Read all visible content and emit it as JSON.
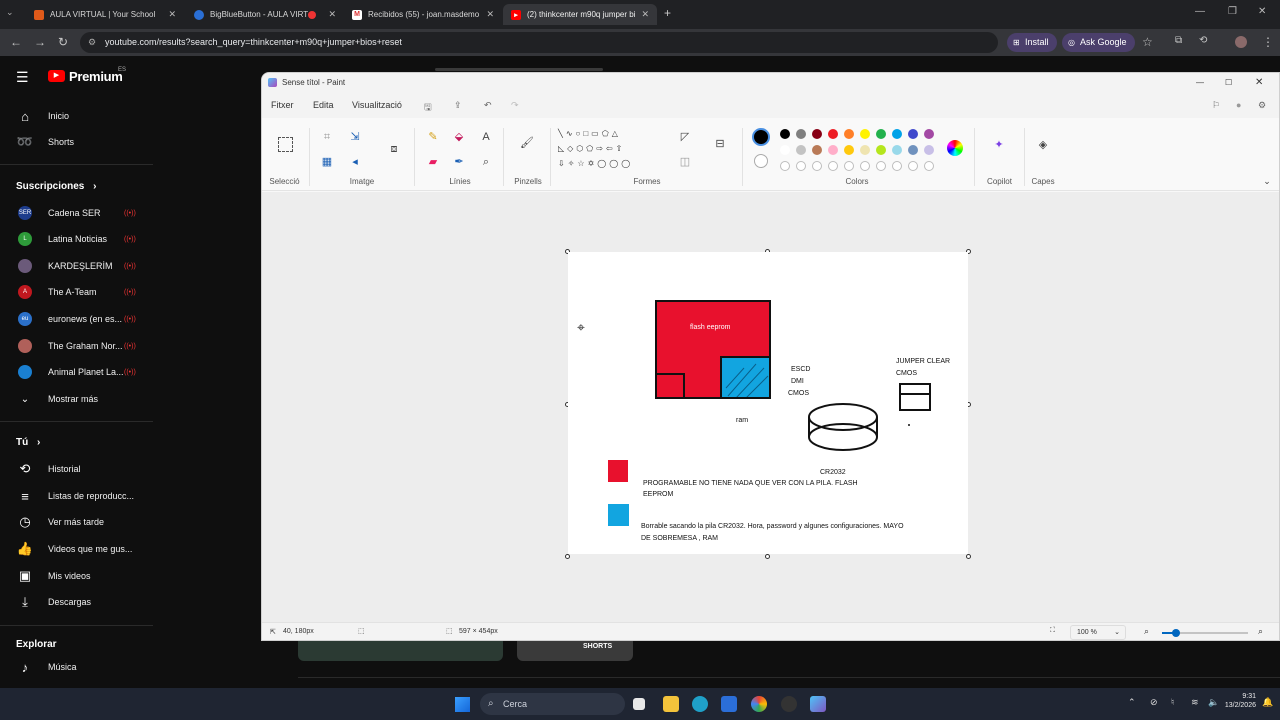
{
  "browser": {
    "tabs": [
      {
        "title": "AULA VIRTUAL | Your School",
        "favicon": "moodle-icon"
      },
      {
        "title": "BigBlueButton - AULA VIRT",
        "favicon": "bigbluebutton-icon"
      },
      {
        "title": "Recibidos (55) - joan.masdemo",
        "favicon": "gmail-icon"
      },
      {
        "title": "(2) thinkcenter m90q jumper bi",
        "favicon": "youtube-icon"
      }
    ],
    "url": "youtube.com/results?search_query=thinkcenter+m90q+jumper+bios+reset",
    "install_label": "Install",
    "ask_google_label": "Ask Google"
  },
  "youtube": {
    "logo_text": "Premium",
    "region": "ES",
    "nav": [
      {
        "label": "Inicio",
        "icon": "home-icon"
      },
      {
        "label": "Shorts",
        "icon": "shorts-icon"
      }
    ],
    "subscriptions_header": "Suscripciones",
    "subscriptions": [
      {
        "label": "Cadena SER",
        "color": "#1d3c8c"
      },
      {
        "label": "Latina Noticias",
        "color": "#2e9b3a"
      },
      {
        "label": "KARDEŞLERİM",
        "color": "#6b5a7a"
      },
      {
        "label": "The A-Team",
        "color": "#c0181f"
      },
      {
        "label": "euronews (en es...",
        "color": "#2b70c9"
      },
      {
        "label": "The Graham Nor...",
        "color": "#b0605a"
      },
      {
        "label": "Animal Planet La...",
        "color": "#1a7fd0"
      }
    ],
    "show_more_label": "Mostrar más",
    "you_header": "Tú",
    "you_items": [
      {
        "label": "Historial",
        "icon": "history-icon"
      },
      {
        "label": "Listas de reproducc...",
        "icon": "playlists-icon"
      },
      {
        "label": "Ver más tarde",
        "icon": "watch-later-icon"
      },
      {
        "label": "Videos que me gus...",
        "icon": "liked-icon"
      },
      {
        "label": "Mis videos",
        "icon": "my-videos-icon"
      },
      {
        "label": "Descargas",
        "icon": "downloads-icon"
      }
    ],
    "explore_header": "Explorar",
    "explore_items": [
      {
        "label": "Música",
        "icon": "music-icon"
      }
    ],
    "shorts_badge": "SHORTS"
  },
  "paint": {
    "window_title": "Sense títol - Paint",
    "menu": [
      "Fitxer",
      "Edita",
      "Visualització"
    ],
    "groups": {
      "selection": "Selecció",
      "image": "Imatge",
      "tools": "Línies",
      "brushes": "Pinzells",
      "shapes": "Formes",
      "colors": "Colors",
      "copilot": "Copilot",
      "layers": "Capes"
    },
    "palette_row1": [
      "#000000",
      "#7f7f7f",
      "#880015",
      "#ed1c24",
      "#ff7f27",
      "#fff200",
      "#22b14c",
      "#00a2e8",
      "#3f48cc",
      "#a349a4"
    ],
    "palette_row2": [
      "#ffffff",
      "#c3c3c3",
      "#b97a57",
      "#ffaec9",
      "#ffc90e",
      "#efe4b0",
      "#b5e61d",
      "#99d9ea",
      "#7092be",
      "#c8bfe7"
    ],
    "status": {
      "cursor_pos": "40, 180px",
      "canvas_size": "597 × 454px",
      "zoom": "100 %"
    },
    "drawing": {
      "flash_label": "flash eeprom",
      "esco_lines": [
        "ESCD",
        "DMI",
        "CMOS"
      ],
      "ram_label": "ram",
      "battery_label": "CR2032",
      "jumper_lines": [
        "JUMPER CLEAR",
        "CMOS"
      ],
      "legend1_lines": [
        "PROGRAMABLE NO TIENE NADA QUE VER CON LA PILA. FLASH",
        "EEPROM"
      ],
      "legend2_lines": [
        "Borrable sacando la pila CR2032. Hora, password y algunes configuraciones. MAYO",
        "DE SOBREMESA  , RAM"
      ],
      "red_color": "#e8112d",
      "blue_color": "#12a5e0"
    }
  },
  "taskbar": {
    "search_placeholder": "Cerca",
    "time": "9:31",
    "date": "13/2/2026"
  }
}
